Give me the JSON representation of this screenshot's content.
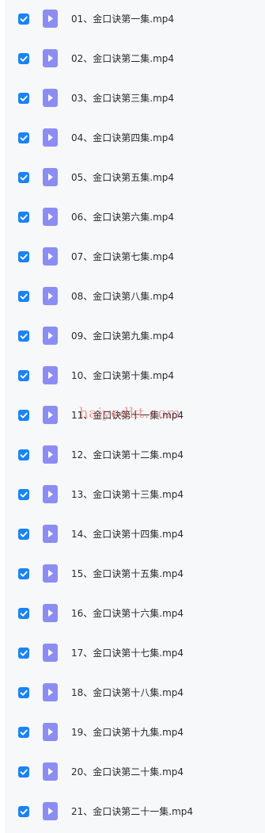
{
  "accent_color": "#1a83f5",
  "file_icon_color": "#8c8df2",
  "files": [
    {
      "name": "01、金口诀第一集.mp4",
      "checked": true
    },
    {
      "name": "02、金口诀第二集.mp4",
      "checked": true
    },
    {
      "name": "03、金口诀第三集.mp4",
      "checked": true
    },
    {
      "name": "04、金口诀第四集.mp4",
      "checked": true
    },
    {
      "name": "05、金口诀第五集.mp4",
      "checked": true
    },
    {
      "name": "06、金口诀第六集.mp4",
      "checked": true
    },
    {
      "name": "07、金口诀第七集.mp4",
      "checked": true
    },
    {
      "name": "08、金口诀第八集.mp4",
      "checked": true
    },
    {
      "name": "09、金口诀第九集.mp4",
      "checked": true
    },
    {
      "name": "10、金口诀第十集.mp4",
      "checked": true
    },
    {
      "name": "11、金口诀第十一集.mp4",
      "checked": true
    },
    {
      "name": "12、金口诀第十二集.mp4",
      "checked": true
    },
    {
      "name": "13、金口诀第十三集.mp4",
      "checked": true
    },
    {
      "name": "14、金口诀第十四集.mp4",
      "checked": true
    },
    {
      "name": "15、金口诀第十五集.mp4",
      "checked": true
    },
    {
      "name": "16、金口诀第十六集.mp4",
      "checked": true
    },
    {
      "name": "17、金口诀第十七集.mp4",
      "checked": true
    },
    {
      "name": "18、金口诀第十八集.mp4",
      "checked": true
    },
    {
      "name": "19、金口诀第十九集.mp4",
      "checked": true
    },
    {
      "name": "20、金口诀第二十集.mp4",
      "checked": true
    },
    {
      "name": "21、金口诀第二十一集.mp4",
      "checked": true
    }
  ],
  "watermark": "haiyedkt.com"
}
